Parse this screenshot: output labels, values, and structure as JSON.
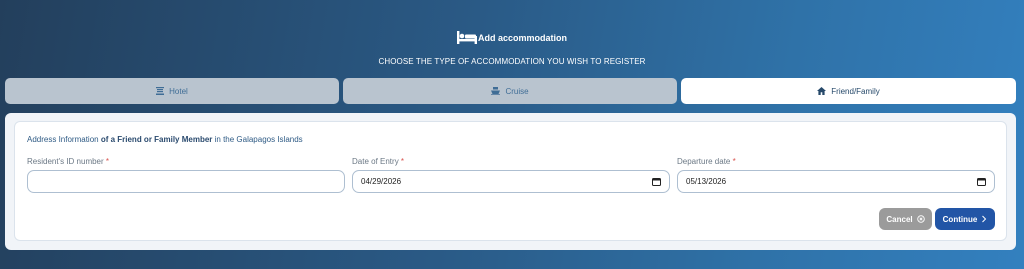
{
  "header": {
    "title": "Add accommodation",
    "subtitle": "CHOOSE THE TYPE OF ACCOMMODATION YOU WISH TO REGISTER",
    "icon": "bed-icon"
  },
  "tabs": [
    {
      "label": "Hotel",
      "icon": "hotel-icon",
      "active": false
    },
    {
      "label": "Cruise",
      "icon": "ship-icon",
      "active": false
    },
    {
      "label": "Friend/Family",
      "icon": "house-icon",
      "active": true
    }
  ],
  "form": {
    "info_prefix": "Address Information ",
    "info_bold": "of a Friend or Family Member",
    "info_suffix": " in the Galapagos Islands",
    "required_mark": "*",
    "fields": [
      {
        "label": "Resident's ID number",
        "value": ""
      },
      {
        "label": "Date of Entry",
        "value": "04/29/2026"
      },
      {
        "label": "Departure date",
        "value": "05/13/2026"
      }
    ]
  },
  "buttons": {
    "cancel": "Cancel",
    "continue": "Continue"
  },
  "colors": {
    "primary": "#2255a6",
    "cancel": "#9b9b9b",
    "tab_inactive": "#b9c4cf",
    "required": "#d9534f"
  }
}
